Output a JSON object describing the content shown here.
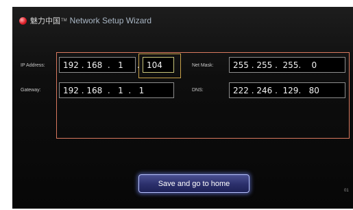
{
  "header": {
    "brand": "魅力中国",
    "trademark": "TM",
    "title": "Network Setup Wizard"
  },
  "labels": {
    "ip_address": "IP Address:",
    "gateway": "Gateway:",
    "net_mask": "Net Mask:",
    "dns": "DNS:"
  },
  "fields": {
    "ip_address_prefix": "192 . 168  .   1",
    "ip_address_last_octet": "104",
    "gateway": "192 . 168  .   1  .   1",
    "net_mask": "255 . 255 .  255.    0",
    "dns": "222 . 246 .  129.   80"
  },
  "buttons": {
    "save": "Save and go to home"
  },
  "page_indicator": "01",
  "colors": {
    "annotation": "#d9795f",
    "accent_button": "#2b2f6b",
    "highlight": "#c8c47a"
  }
}
